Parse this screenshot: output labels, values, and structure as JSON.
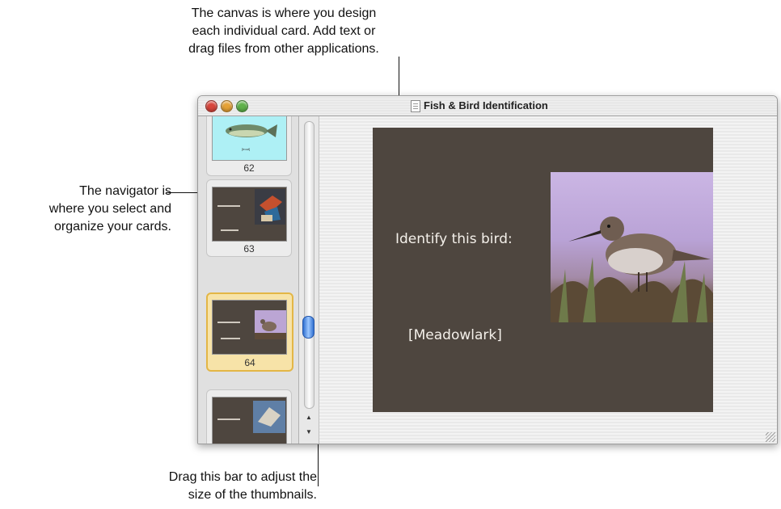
{
  "callouts": {
    "canvas": [
      "The canvas is where you design",
      "each individual card. Add text or",
      "drag files from other applications."
    ],
    "navigator": [
      "The navigator is",
      "where you select and",
      "organize your cards."
    ],
    "drag_bar": [
      "Drag this bar to adjust the",
      "size of the thumbnails."
    ]
  },
  "window": {
    "title": "Fish & Bird Identification"
  },
  "navigator": {
    "thumbnails": [
      {
        "number": "62",
        "caption": "[trout]",
        "selected": false
      },
      {
        "number": "63",
        "caption": "",
        "selected": false
      },
      {
        "number": "64",
        "caption": "",
        "selected": true
      },
      {
        "number": "",
        "caption": "",
        "selected": false
      }
    ]
  },
  "card": {
    "prompt": "Identify this bird:",
    "answer": "[Meadowlark]"
  },
  "scroll": {
    "up_icon": "arrow-up-icon",
    "down_icon": "arrow-down-icon"
  },
  "colors": {
    "card_background": "#4e463f",
    "selection_highlight": "#f7e3a8",
    "scroll_thumb": "#2f6fd0"
  }
}
